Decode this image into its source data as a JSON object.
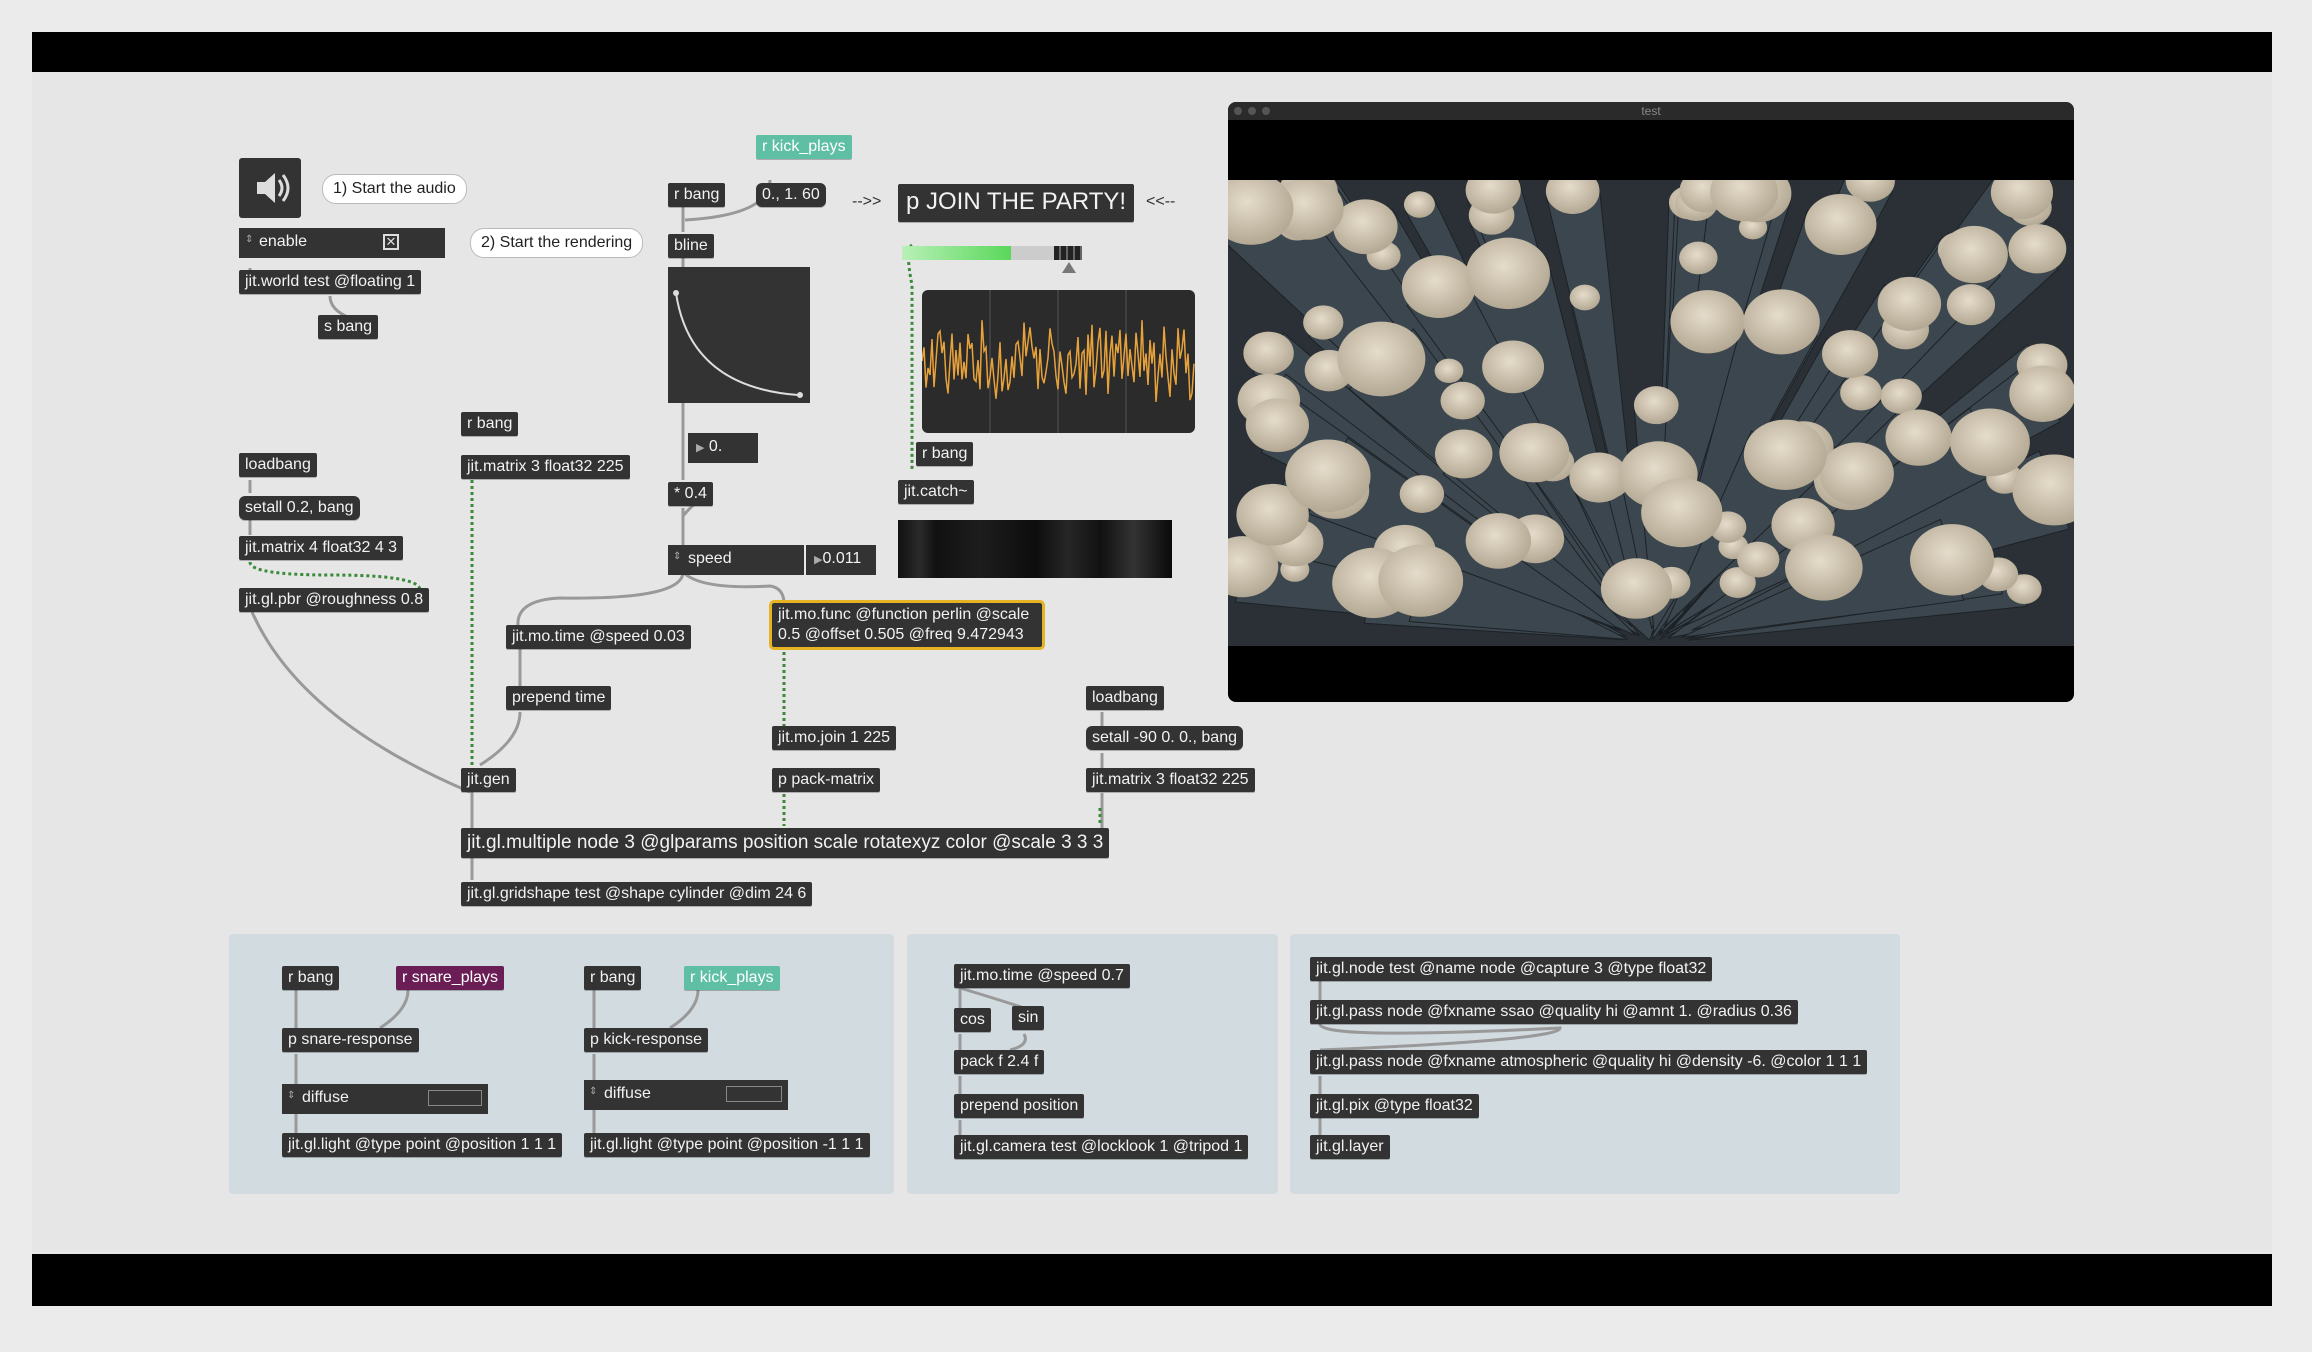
{
  "patch": {
    "comment_audio": "1) Start the audio",
    "comment_render": "2) Start the rendering",
    "enable_label": "enable",
    "world": "jit.world test @floating 1",
    "s_bang": "s bang",
    "loadbang1": "loadbang",
    "setall1": "setall 0.2, bang",
    "matrix4": "jit.matrix 4 float32 4 3",
    "pbr": "jit.gl.pbr @roughness 0.8",
    "rbang_matrix": "r bang",
    "matrix3": "jit.matrix 3 float32 225",
    "rbang_line": "r bang",
    "kick_plays": "r kick_plays",
    "line_msg": "0., 1. 60",
    "bline": "bline",
    "arrow_left": "-->>",
    "arrow_right": "<<--",
    "join_party": "p JOIN THE PARTY!",
    "float_val": "0.",
    "mult": "* 0.4",
    "speed_label": "speed",
    "speed_val": "0.011",
    "rbang_catch": "r bang",
    "catch": "jit.catch~",
    "mo_time": "jit.mo.time @speed 0.03",
    "prepend_time": "prepend time",
    "mo_func": "jit.mo.func @function perlin @scale 0.5 @offset 0.505 @freq 9.472943",
    "mo_join": "jit.mo.join 1 225",
    "pack_matrix": "p pack-matrix",
    "jit_gen": "jit.gen",
    "loadbang2": "loadbang",
    "setall2": "setall -90 0. 0., bang",
    "matrix3b": "jit.matrix 3 float32 225",
    "multiple": "jit.gl.multiple node 3 @glparams position scale rotatexyz color @scale 3 3 3",
    "gridshape": "jit.gl.gridshape test @shape cylinder @dim 24 6"
  },
  "panel1": {
    "rbang_a": "r bang",
    "snare_plays": "r snare_plays",
    "snare_response": "p snare-response",
    "diffuse_a": "diffuse",
    "light_a": "jit.gl.light @type point @position 1 1 1",
    "rbang_b": "r bang",
    "kick_plays": "r kick_plays",
    "kick_response": "p kick-response",
    "diffuse_b": "diffuse",
    "light_b": "jit.gl.light @type point @position -1 1 1"
  },
  "panel2": {
    "mo_time": "jit.mo.time @speed 0.7",
    "cos": "cos",
    "sin": "sin",
    "pack": "pack f 2.4 f",
    "prepend_pos": "prepend position",
    "camera": "jit.gl.camera test @locklook 1 @tripod 1"
  },
  "panel3": {
    "node": "jit.gl.node test @name node @capture 3 @type float32",
    "pass_ssao": "jit.gl.pass node @fxname ssao @quality hi @amnt 1. @radius 0.36",
    "pass_atmo": "jit.gl.pass node @fxname atmospheric @quality hi @density -6. @color 1 1 1",
    "pix": "jit.gl.pix @type float32",
    "layer": "jit.gl.layer"
  },
  "video_window": {
    "title": "test"
  },
  "colors": {
    "teal": "#5fbfa4",
    "purple": "#6b1e55",
    "highlight": "#e6b422",
    "scope": "#e8a23a"
  },
  "icons": [
    "speaker-icon",
    "toggle-x-icon"
  ],
  "meter_level": 0.72
}
